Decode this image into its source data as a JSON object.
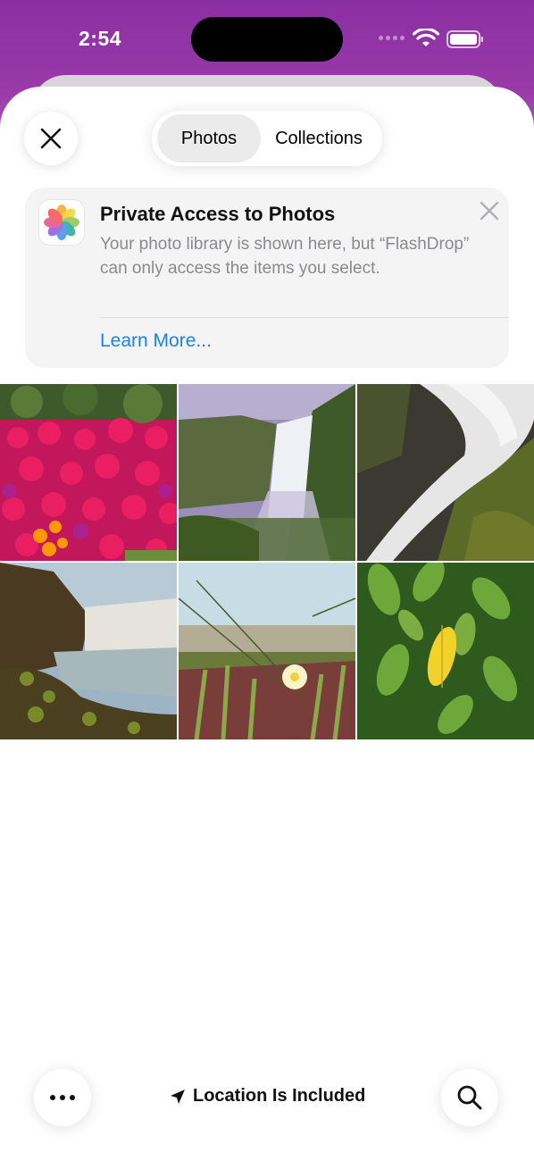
{
  "status_bar": {
    "time": "2:54"
  },
  "tabs": [
    {
      "label": "Photos",
      "active": true
    },
    {
      "label": "Collections",
      "active": false
    }
  ],
  "banner": {
    "title": "Private Access to Photos",
    "body": "Your photo library is shown here, but “FlashDrop” can only access the items you select.",
    "link": "Learn More..."
  },
  "photos": [
    {
      "subject": "pink flowers"
    },
    {
      "subject": "waterfall cliff"
    },
    {
      "subject": "waterfall rocks"
    },
    {
      "subject": "waterfall mist"
    },
    {
      "subject": "ice plant flower"
    },
    {
      "subject": "green leaves"
    }
  ],
  "bottom_bar": {
    "location_label": "Location Is Included"
  },
  "colors": {
    "accent": "#1a82e6",
    "gradient_top": "#8a2fa3"
  }
}
